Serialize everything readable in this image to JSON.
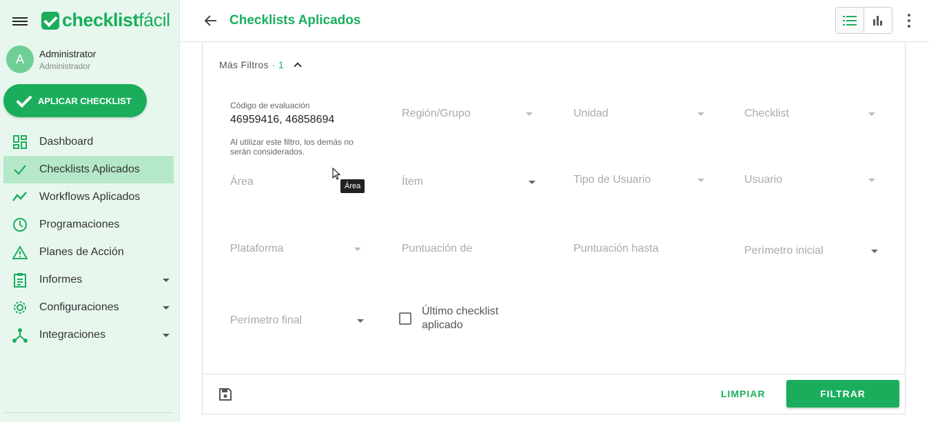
{
  "app": {
    "logo_bold": "checklist",
    "logo_light": "fácil"
  },
  "user": {
    "initial": "A",
    "name": "Administrator",
    "role": "Administrador"
  },
  "sidebar": {
    "apply_button": "APLICAR CHECKLIST",
    "items": [
      {
        "label": "Dashboard",
        "icon": "dashboard-icon"
      },
      {
        "label": "Checklists Aplicados",
        "icon": "check-icon",
        "active": true
      },
      {
        "label": "Workflows Aplicados",
        "icon": "trend-icon"
      },
      {
        "label": "Programaciones",
        "icon": "clock-icon"
      },
      {
        "label": "Planes de Acción",
        "icon": "warning-icon"
      },
      {
        "label": "Informes",
        "icon": "clipboard-icon",
        "expandable": true
      },
      {
        "label": "Configuraciones",
        "icon": "gear-icon",
        "expandable": true
      },
      {
        "label": "Integraciones",
        "icon": "integration-icon",
        "expandable": true
      }
    ]
  },
  "header": {
    "title": "Checklists Aplicados"
  },
  "filters": {
    "more_filters_label": "Más Filtros",
    "more_filters_count": "· 1",
    "code": {
      "label": "Código de evaluación",
      "value": "46959416, 46858694",
      "help": "Al utilizar este filtro, los demás no serán considerados."
    },
    "region": "Región/Grupo",
    "unit": "Unidad",
    "checklist": "Checklist",
    "area": "Área",
    "item": "Ítem",
    "user_type": "Tipo de Usuario",
    "user": "Usuario",
    "platform": "Plataforma",
    "score_from": "Puntuación de",
    "score_to": "Puntuación hasta",
    "perimeter_start": "Perímetro inicial",
    "perimeter_end": "Perímetro final",
    "last_checklist": "Último checklist aplicado"
  },
  "actions": {
    "clear": "LIMPIAR",
    "filter": "FILTRAR"
  },
  "tooltip": {
    "text": "Área"
  },
  "colors": {
    "brand": "#1aae5c",
    "sidebar_bg": "#e8f7ee",
    "active_bg": "#b5e8c9"
  }
}
